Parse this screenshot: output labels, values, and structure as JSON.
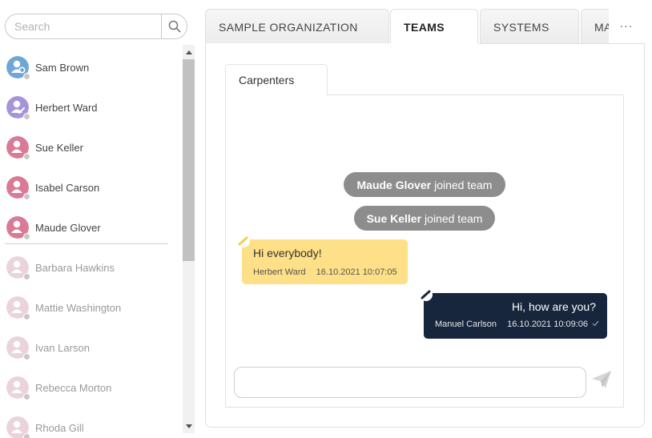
{
  "search": {
    "placeholder": "Search",
    "value": ""
  },
  "users": [
    {
      "name": "Sam Brown",
      "status": "online",
      "avatar_color": "#6ea6d8",
      "avatar_kind": "settings"
    },
    {
      "name": "Herbert Ward",
      "status": "online",
      "avatar_color": "#a694d9",
      "avatar_kind": "edit"
    },
    {
      "name": "Sue Keller",
      "status": "online",
      "avatar_color": "#d97a97",
      "avatar_kind": "person"
    },
    {
      "name": "Isabel Carson",
      "status": "online",
      "avatar_color": "#d97a97",
      "avatar_kind": "person"
    },
    {
      "name": "Maude Glover",
      "status": "online",
      "avatar_color": "#d97a97",
      "avatar_kind": "person"
    },
    {
      "name": "Barbara Hawkins",
      "status": "offline",
      "avatar_color": "#ebd3da",
      "avatar_kind": "person"
    },
    {
      "name": "Mattie Washington",
      "status": "offline",
      "avatar_color": "#ebd3da",
      "avatar_kind": "person"
    },
    {
      "name": "Ivan Larson",
      "status": "offline",
      "avatar_color": "#ebd3da",
      "avatar_kind": "person"
    },
    {
      "name": "Rebecca Morton",
      "status": "offline",
      "avatar_color": "#ebd3da",
      "avatar_kind": "person"
    },
    {
      "name": "Rhoda Gill",
      "status": "offline",
      "avatar_color": "#ebd3da",
      "avatar_kind": "person"
    }
  ],
  "tabs": [
    {
      "label": "SAMPLE ORGANIZATION",
      "active": false
    },
    {
      "label": "TEAMS",
      "active": true
    },
    {
      "label": "SYSTEMS",
      "active": false
    },
    {
      "label": "MA",
      "active": false
    }
  ],
  "more_label": "···",
  "team_tab": {
    "label": "Carpenters"
  },
  "system_messages": [
    {
      "name": "Maude Glover",
      "text": "joined team"
    },
    {
      "name": "Sue Keller",
      "text": "joined team"
    }
  ],
  "messages": [
    {
      "direction": "incoming",
      "text": "Hi everybody!",
      "author": "Herbert Ward",
      "time": "16.10.2021 10:07:05",
      "color": "#fde087"
    },
    {
      "direction": "outgoing",
      "text": "Hi, how are you?",
      "author": "Manuel Carlson",
      "time": "16.10.2021 10:09:06",
      "read_icon": "check-icon",
      "color": "#17263d"
    }
  ],
  "composer": {
    "placeholder": "",
    "value": ""
  },
  "icons": {
    "search": "search-icon",
    "send": "send-icon",
    "edit": "pencil-icon"
  }
}
